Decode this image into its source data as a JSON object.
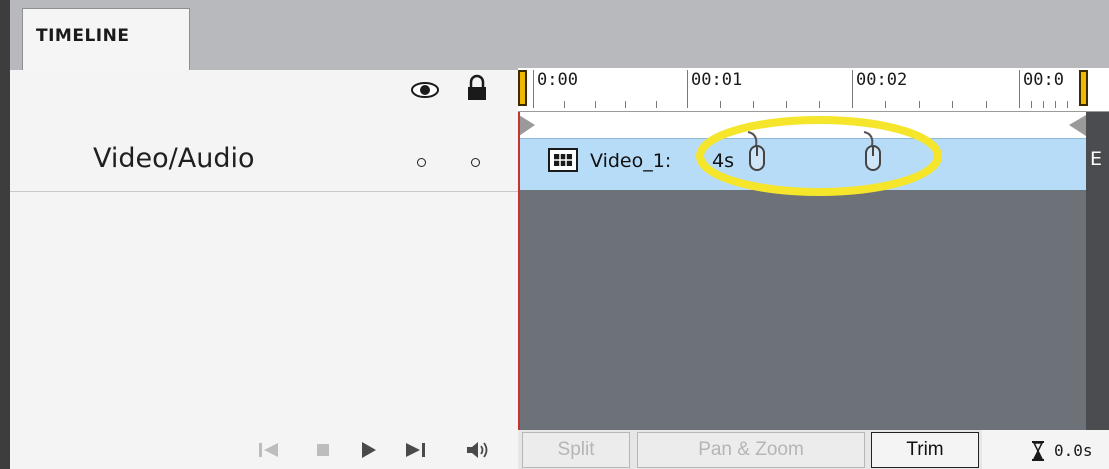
{
  "panel": {
    "tab_label": "TIMELINE"
  },
  "track": {
    "label": "Video/Audio"
  },
  "ruler": {
    "ticks": [
      "0:00",
      "00:01",
      "00:02",
      "00:0"
    ]
  },
  "clip": {
    "name": "Video_1:",
    "duration": "4s",
    "right_edge_letter": "E"
  },
  "transport": {
    "split_label": "Split",
    "pan_zoom_label": "Pan & Zoom",
    "trim_label": "Trim",
    "time": "0.0s"
  },
  "colors": {
    "clip_fill": "#b6dcf7",
    "track_area": "#6d7178",
    "playhead": "#c6322e",
    "highlight_ellipse": "#f5e62c",
    "handle": "#f0b800"
  },
  "icons": [
    "eye-icon",
    "lock-icon",
    "film-strip-icon",
    "mouse-icon",
    "skip-back-icon",
    "stop-icon",
    "play-icon",
    "skip-forward-icon",
    "volume-icon",
    "hourglass-icon"
  ]
}
